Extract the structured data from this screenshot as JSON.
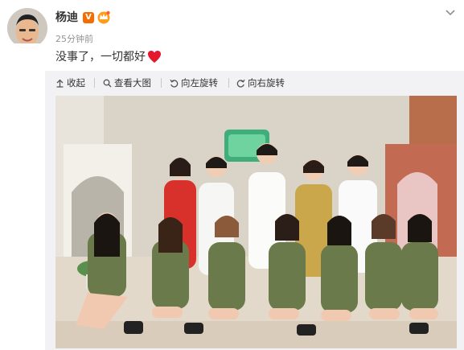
{
  "post": {
    "author": "杨迪",
    "verified_badge": "V",
    "time": "25分钟前",
    "text": "没事了，一切都好"
  },
  "toolbar": {
    "collapse_label": "收起",
    "view_large_label": "查看大图",
    "rotate_left_label": "向左旋转",
    "rotate_right_label": "向右旋转"
  },
  "photo": {
    "description": "group photo on studio set"
  },
  "icons": {
    "caret": "chevron-down-icon",
    "heart": "red-heart-emoji",
    "crown": "member-crown-icon"
  },
  "colors": {
    "badge": "#f56c00",
    "heart": "#e6162d",
    "muted": "#939393",
    "toolbar_bg": "#f2f2f5"
  }
}
